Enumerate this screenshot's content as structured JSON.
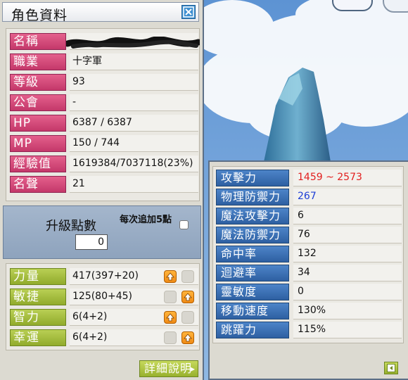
{
  "window": {
    "title": "角色資料"
  },
  "info": [
    {
      "key": "name",
      "label": "名稱",
      "value": ""
    },
    {
      "key": "job",
      "label": "職業",
      "value": "十字軍"
    },
    {
      "key": "level",
      "label": "等級",
      "value": "93"
    },
    {
      "key": "guild",
      "label": "公會",
      "value": "-"
    },
    {
      "key": "hp",
      "label": "HP",
      "value": "6387 / 6387"
    },
    {
      "key": "mp",
      "label": "MP",
      "value": "150 / 744"
    },
    {
      "key": "exp",
      "label": "經驗值",
      "value": "1619384/7037118(23%)"
    },
    {
      "key": "fame",
      "label": "名聲",
      "value": "21"
    }
  ],
  "ability_points": {
    "label": "升級點數",
    "value": "0",
    "auto_label": "每次追加5點"
  },
  "stats": [
    {
      "key": "str",
      "label": "力量",
      "value": "417(397+20)",
      "button_enabled": true,
      "button_side": "left"
    },
    {
      "key": "dex",
      "label": "敏捷",
      "value": "125(80+45)",
      "button_enabled": true,
      "button_side": "right"
    },
    {
      "key": "int",
      "label": "智力",
      "value": "6(4+2)",
      "button_enabled": true,
      "button_side": "left"
    },
    {
      "key": "luk",
      "label": "幸運",
      "value": "6(4+2)",
      "button_enabled": true,
      "button_side": "right"
    }
  ],
  "detail_button": {
    "label": "詳細說明"
  },
  "details": [
    {
      "label": "攻擊力",
      "value": "1459 ~ 2573",
      "color": "#e21e1e"
    },
    {
      "label": "物理防禦力",
      "value": "267",
      "color": "#1e3fd6"
    },
    {
      "label": "魔法攻擊力",
      "value": "6",
      "color": "#111111"
    },
    {
      "label": "魔法防禦力",
      "value": "76",
      "color": "#111111"
    },
    {
      "label": "命中率",
      "value": "132",
      "color": "#111111"
    },
    {
      "label": "迴避率",
      "value": "34",
      "color": "#111111"
    },
    {
      "label": "靈敏度",
      "value": "0",
      "color": "#111111"
    },
    {
      "label": "移動速度",
      "value": "130%",
      "color": "#111111"
    },
    {
      "label": "跳躍力",
      "value": "115%",
      "color": "#111111"
    }
  ],
  "icons": {
    "close": "close-icon",
    "up_arrow": "up-arrow-icon",
    "back": "back-arrow-icon"
  }
}
